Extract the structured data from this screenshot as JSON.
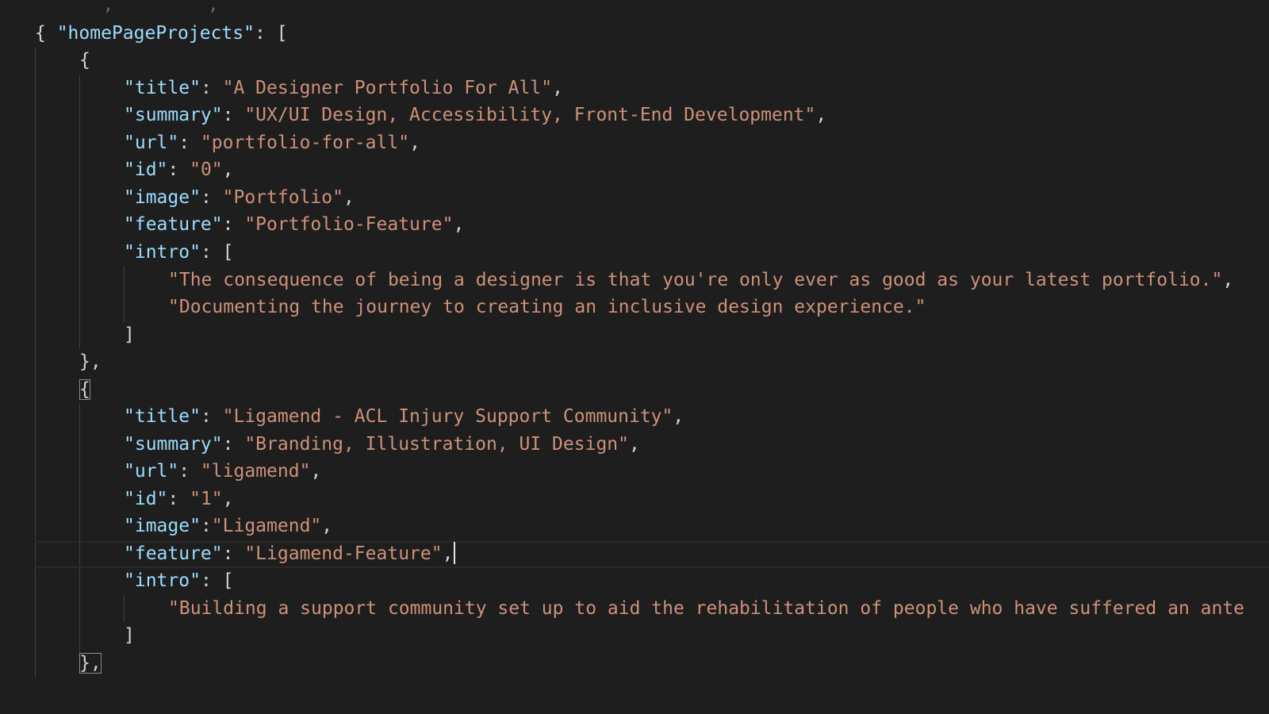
{
  "top_fragment": "   ,         ,   _       ",
  "root_open": "{ ",
  "root_key": "\"homePageProjects\"",
  "root_after": ": [",
  "projects": [
    {
      "open": "{",
      "title_key": "\"title\"",
      "title_value": "\"A Designer Portfolio For All\"",
      "summary_key": "\"summary\"",
      "summary_value": "\"UX/UI Design, Accessibility, Front-End Development\"",
      "url_key": "\"url\"",
      "url_value": "\"portfolio-for-all\"",
      "id_key": "\"id\"",
      "id_value": "\"0\"",
      "image_key": "\"image\"",
      "image_value": "\"Portfolio\"",
      "feature_key": "\"feature\"",
      "feature_value": "\"Portfolio-Feature\"",
      "intro_key": "\"intro\"",
      "intro": [
        "\"The consequence of being a designer is that you're only ever as good as your latest portfolio.\"",
        "\"Documenting the journey to creating an inclusive design experience.\""
      ],
      "intro_close": "]",
      "close": "},"
    },
    {
      "open": "{",
      "title_key": "\"title\"",
      "title_value": "\"Ligamend - ACL Injury Support Community\"",
      "summary_key": "\"summary\"",
      "summary_value": "\"Branding, Illustration, UI Design\"",
      "url_key": "\"url\"",
      "url_value": "\"ligamend\"",
      "id_key": "\"id\"",
      "id_value": "\"1\"",
      "image_key": "\"image\"",
      "image_value": "\"Ligamend\"",
      "feature_key": "\"feature\"",
      "feature_value": "\"Ligamend-Feature\"",
      "intro_key": "\"intro\"",
      "intro": [
        "\"Building a support community set up to aid the rehabilitation of people who have suffered an ante"
      ],
      "intro_close": "]",
      "close": "},"
    }
  ],
  "colors": {
    "background": "#1e1e1e",
    "key": "#9cdcfe",
    "string": "#ce9178",
    "punctuation": "#d4d4d4"
  }
}
